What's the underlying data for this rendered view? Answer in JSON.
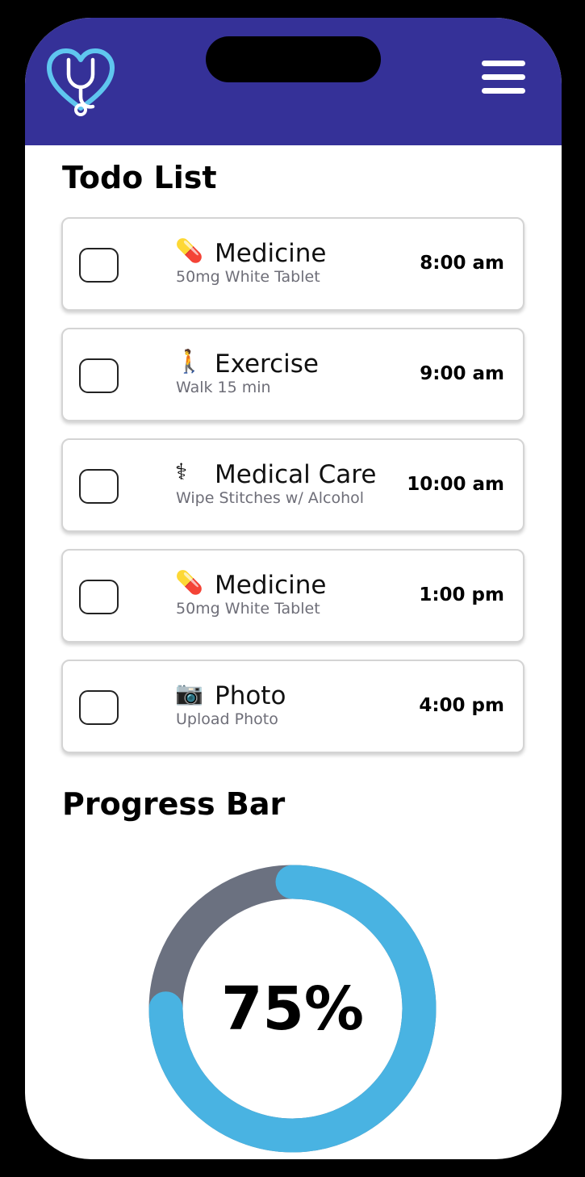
{
  "header": {
    "logo_icon": "heart-stethoscope-icon",
    "menu_icon": "hamburger-menu-icon",
    "background_color": "#353198"
  },
  "todo": {
    "title": "Todo List",
    "items": [
      {
        "icon": "💊",
        "title": "Medicine",
        "subtitle": "50mg White Tablet",
        "time": "8:00 am",
        "checked": false
      },
      {
        "icon": "🚶",
        "title": "Exercise",
        "subtitle": "Walk 15 min",
        "time": "9:00 am",
        "checked": false
      },
      {
        "icon": "⚕",
        "title": "Medical Care",
        "subtitle": "Wipe Stitches w/ Alcohol",
        "time": "10:00 am",
        "checked": false
      },
      {
        "icon": "💊",
        "title": "Medicine",
        "subtitle": "50mg White Tablet",
        "time": "1:00 pm",
        "checked": false
      },
      {
        "icon": "📷",
        "title": "Photo",
        "subtitle": "Upload Photo",
        "time": "4:00 pm",
        "checked": false
      }
    ]
  },
  "progress": {
    "title": "Progress Bar",
    "value": 0.75,
    "label": "75%",
    "fill_color": "#49b3e2",
    "track_color": "#6b7180"
  }
}
